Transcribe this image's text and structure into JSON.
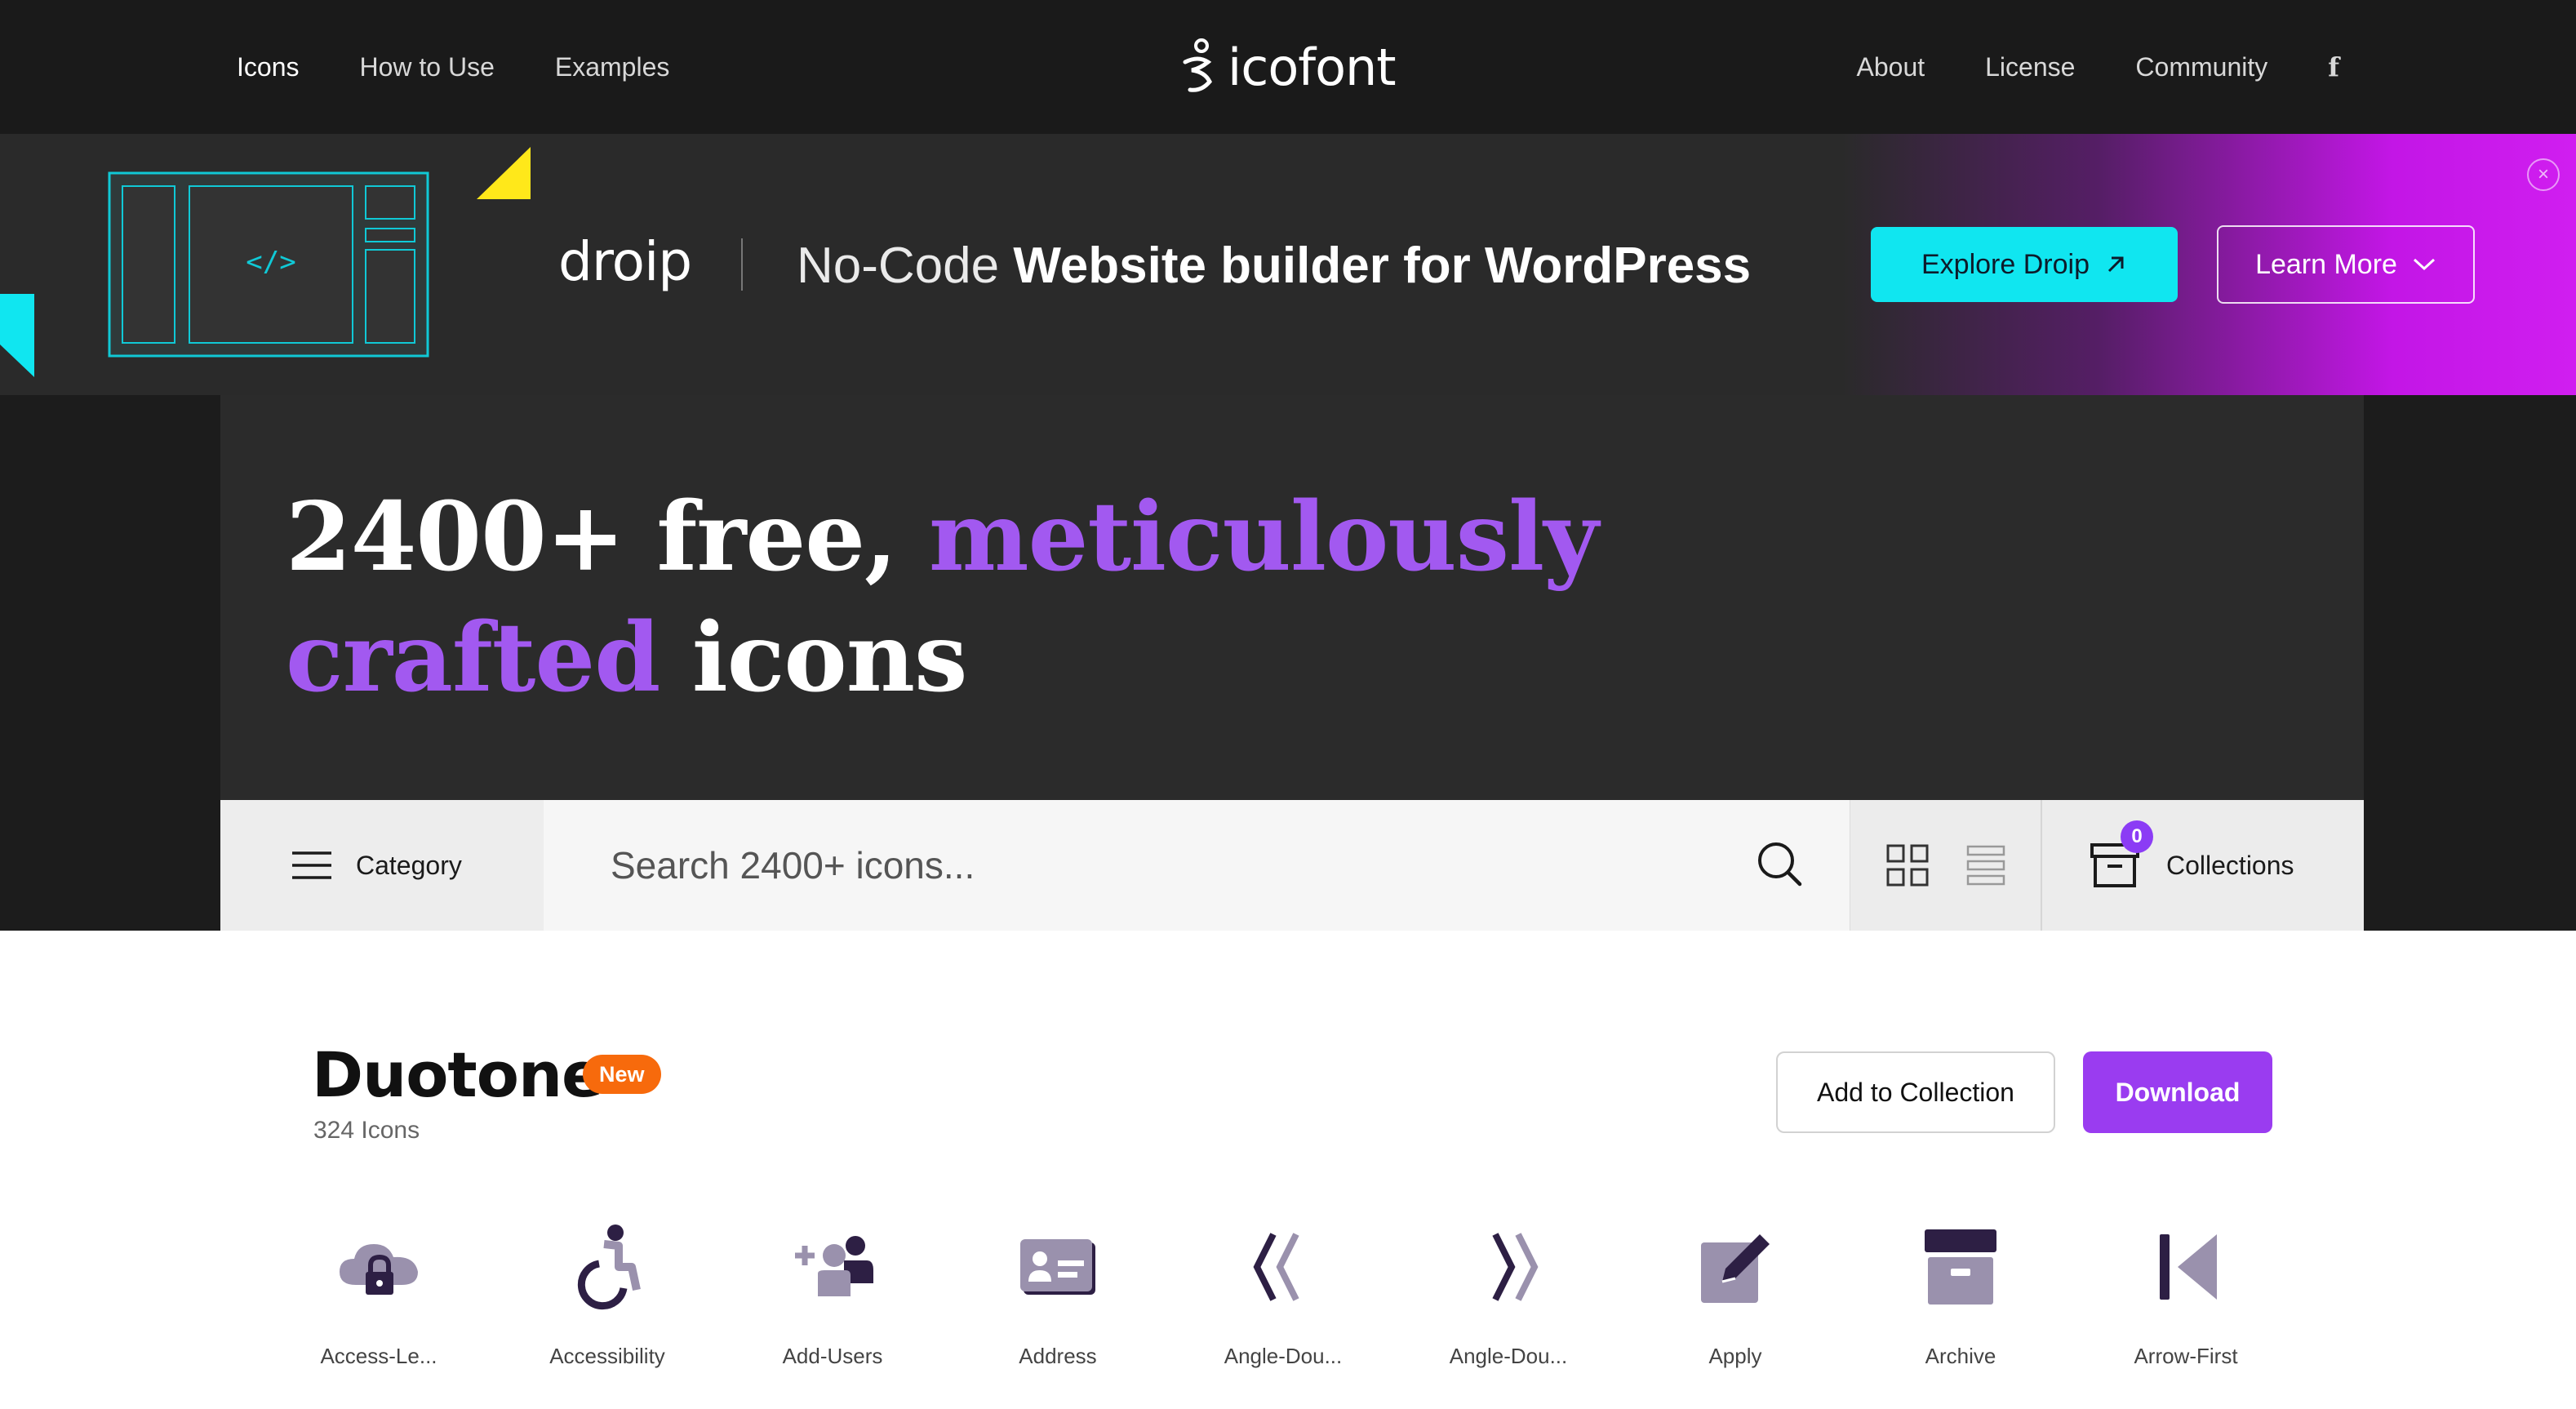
{
  "nav": {
    "left": [
      "Icons",
      "How to Use",
      "Examples"
    ],
    "right": [
      "About",
      "License",
      "Community"
    ],
    "logo_text": "icofont",
    "facebook_label": "f"
  },
  "banner": {
    "brand": "droip",
    "headline_light": "No-Code ",
    "headline_bold": "Website builder for WordPress",
    "explore_label": "Explore Droip",
    "learn_label": "Learn More",
    "close_symbol": "×",
    "code_glyph": "</>"
  },
  "hero": {
    "line1_plain": "2400+ free, ",
    "line1_accent": "meticulously",
    "line2_accent": "crafted",
    "line2_plain": " icons"
  },
  "searchbar": {
    "category_label": "Category",
    "search_placeholder": "Search 2400+ icons...",
    "collections_label": "Collections",
    "collections_count": "0"
  },
  "pack": {
    "title": "Duotone",
    "badge": "New",
    "count": "324 Icons",
    "add_label": "Add to Collection",
    "download_label": "Download"
  },
  "icons": [
    {
      "label": "Access-Le...",
      "icon": "cloud-lock-icon"
    },
    {
      "label": "Accessibility",
      "icon": "wheelchair-icon"
    },
    {
      "label": "Add-Users",
      "icon": "add-users-icon"
    },
    {
      "label": "Address",
      "icon": "address-card-icon"
    },
    {
      "label": "Angle-Dou...",
      "icon": "angle-double-left-icon"
    },
    {
      "label": "Angle-Dou...",
      "icon": "angle-double-right-icon"
    },
    {
      "label": "Apply",
      "icon": "apply-edit-icon"
    },
    {
      "label": "Archive",
      "icon": "archive-icon"
    },
    {
      "label": "Arrow-First",
      "icon": "arrow-first-icon"
    }
  ],
  "colors": {
    "accent_purple": "#a259f0",
    "download_purple": "#9a3cf0",
    "cyan": "#10e6f0",
    "new_orange": "#f76a0c",
    "icon_dark": "#2d1f44",
    "icon_light": "#9a91ad"
  }
}
